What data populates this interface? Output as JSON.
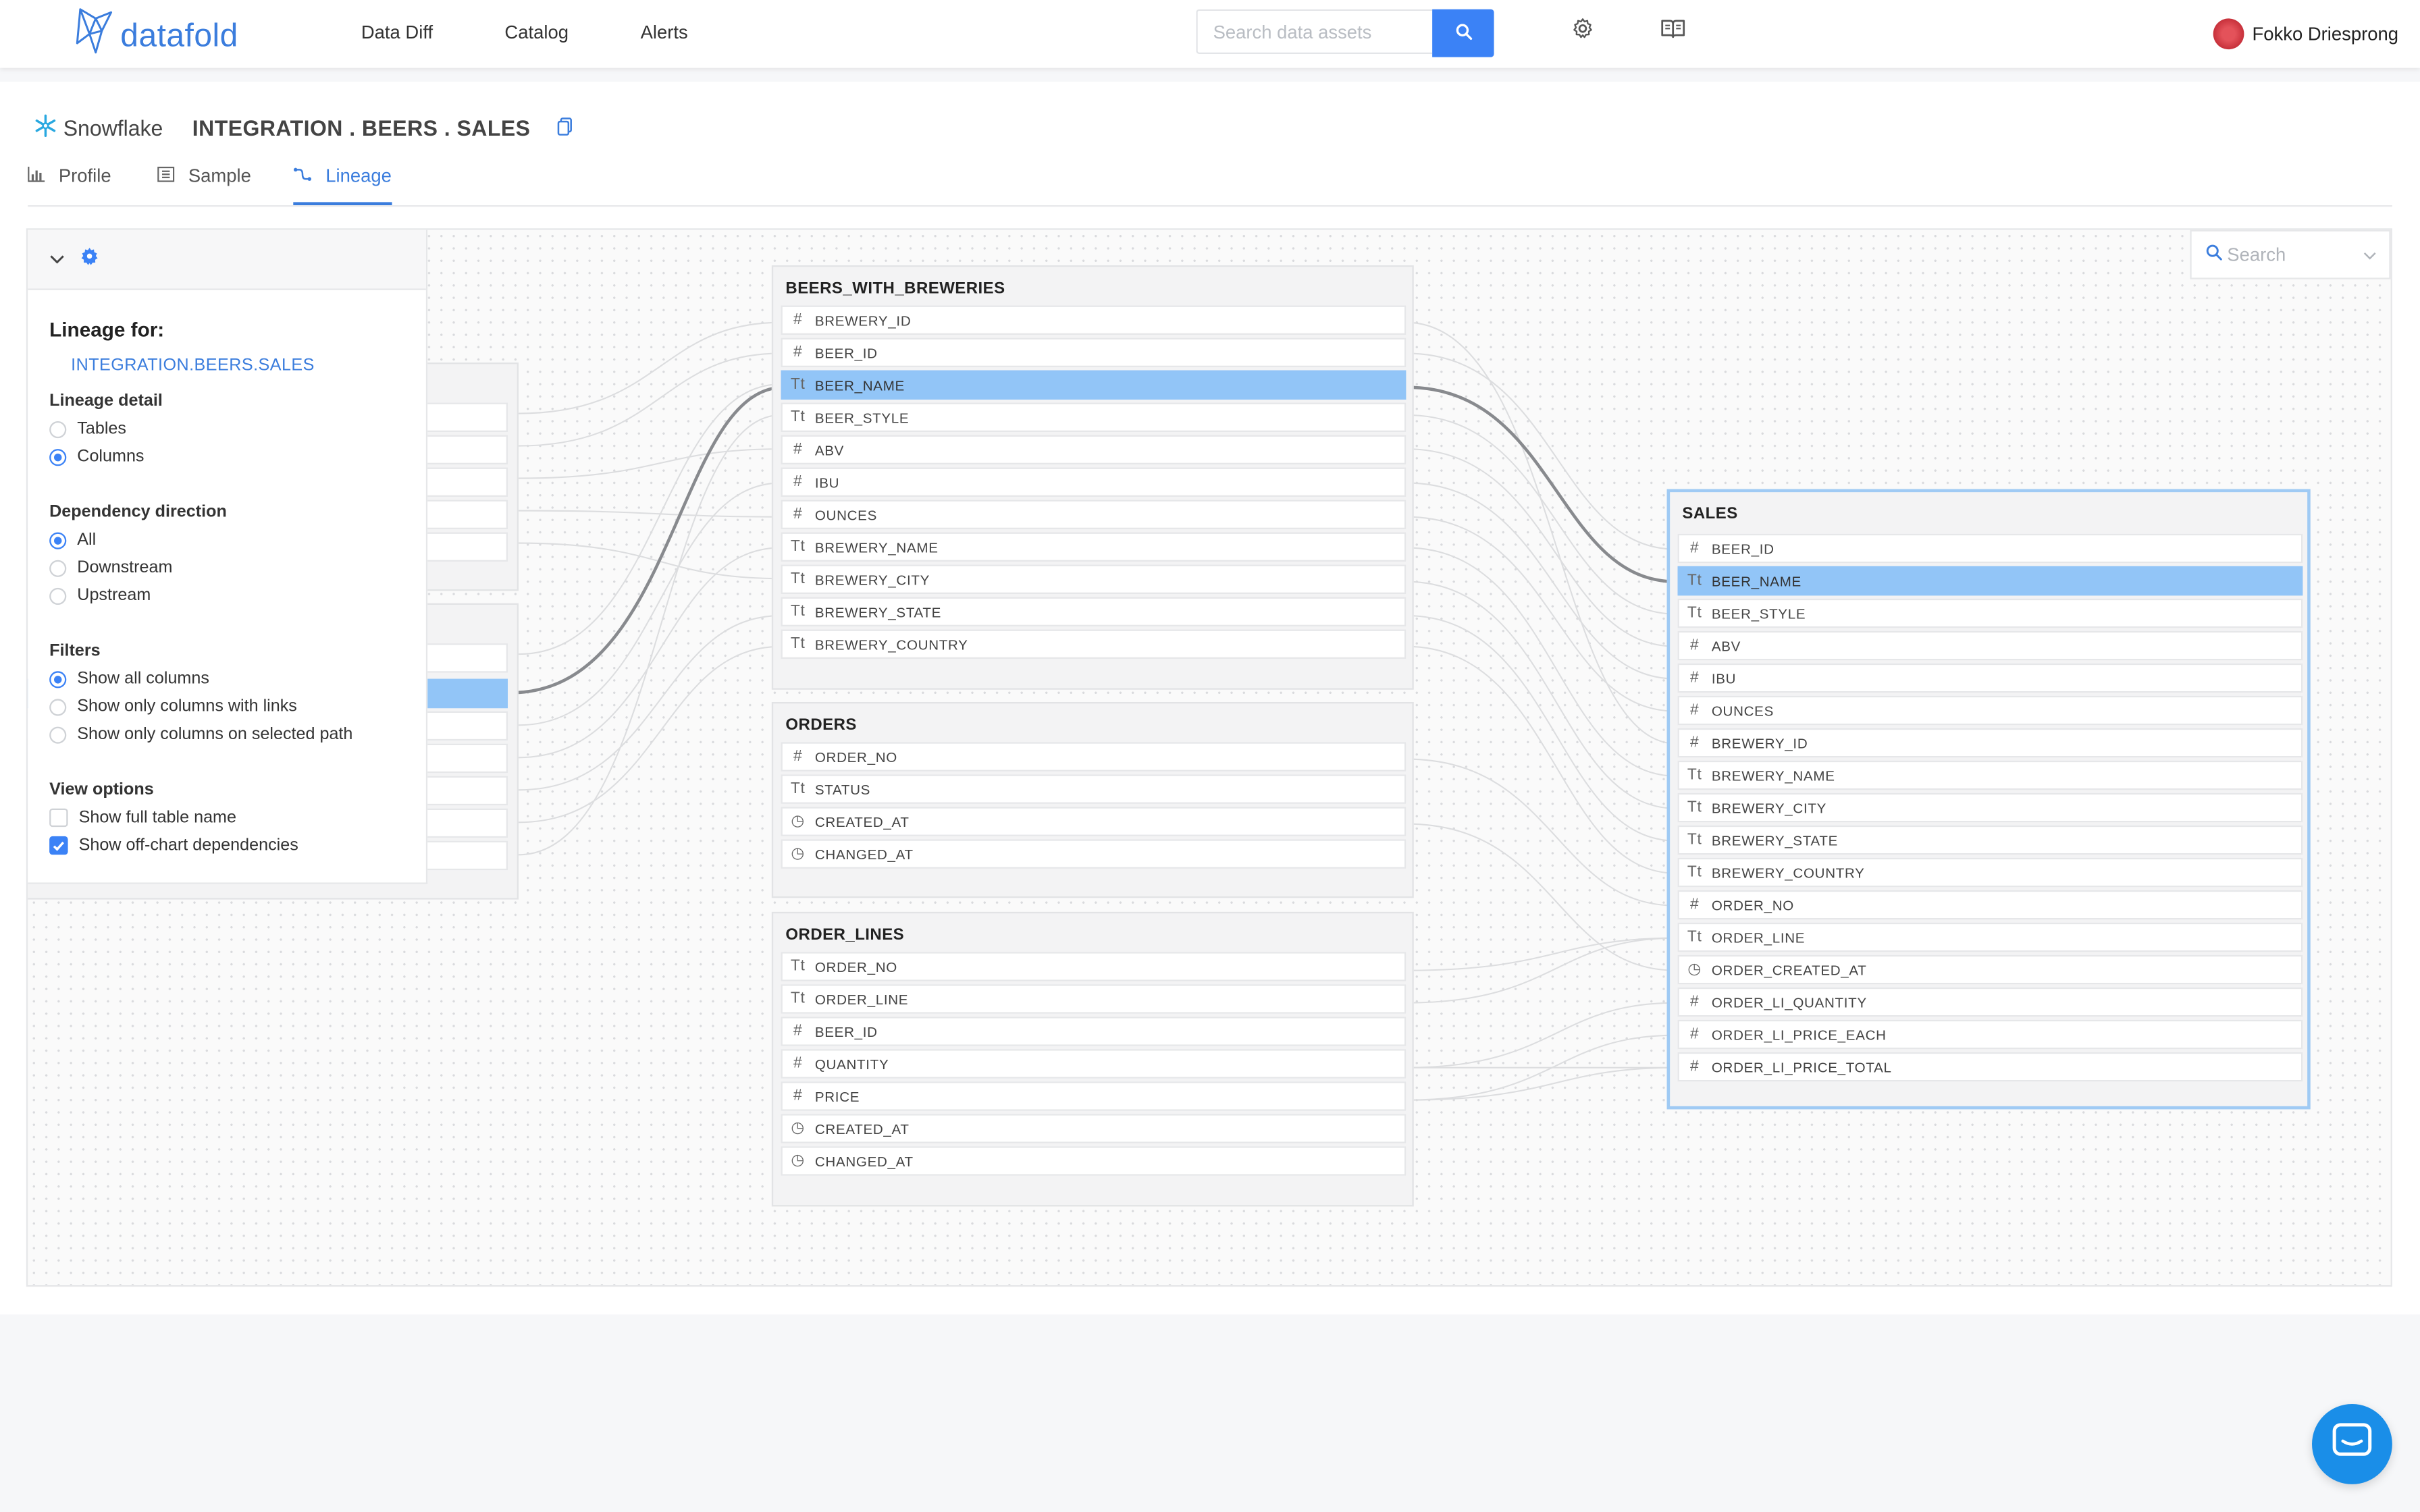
{
  "app": {
    "brand": "datafold"
  },
  "nav": {
    "items": [
      "Data Diff",
      "Catalog",
      "Alerts"
    ]
  },
  "search": {
    "placeholder": "Search data assets"
  },
  "user": {
    "name": "Fokko Driesprong"
  },
  "breadcrumb": {
    "source": "Snowflake",
    "path": "INTEGRATION . BEERS . SALES"
  },
  "tabs": [
    {
      "label": "Profile",
      "active": false
    },
    {
      "label": "Sample",
      "active": false
    },
    {
      "label": "Lineage",
      "active": true
    }
  ],
  "settings": {
    "lineage_for_label": "Lineage for:",
    "lineage_for_value": "INTEGRATION.BEERS.SALES",
    "lineage_detail": {
      "title": "Lineage detail",
      "options": [
        "Tables",
        "Columns"
      ],
      "selected": "Columns"
    },
    "dependency_direction": {
      "title": "Dependency direction",
      "options": [
        "All",
        "Downstream",
        "Upstream"
      ],
      "selected": "All"
    },
    "filters": {
      "title": "Filters",
      "options": [
        "Show all columns",
        "Show only columns with links",
        "Show only columns on selected path"
      ],
      "selected": "Show all columns"
    },
    "view_options": {
      "title": "View options",
      "options": [
        {
          "label": "Show full table name",
          "checked": false
        },
        {
          "label": "Show off-chart dependencies",
          "checked": true
        }
      ]
    }
  },
  "canvas_search": {
    "placeholder": "Search"
  },
  "tables": {
    "beers_with_breweries": {
      "name": "BEERS_WITH_BREWERIES",
      "columns": [
        {
          "name": "BREWERY_ID",
          "type": "number"
        },
        {
          "name": "BEER_ID",
          "type": "number"
        },
        {
          "name": "BEER_NAME",
          "type": "text",
          "highlighted": true
        },
        {
          "name": "BEER_STYLE",
          "type": "text"
        },
        {
          "name": "ABV",
          "type": "number"
        },
        {
          "name": "IBU",
          "type": "number"
        },
        {
          "name": "OUNCES",
          "type": "number"
        },
        {
          "name": "BREWERY_NAME",
          "type": "text"
        },
        {
          "name": "BREWERY_CITY",
          "type": "text"
        },
        {
          "name": "BREWERY_STATE",
          "type": "text"
        },
        {
          "name": "BREWERY_COUNTRY",
          "type": "text"
        }
      ]
    },
    "orders": {
      "name": "ORDERS",
      "columns": [
        {
          "name": "ORDER_NO",
          "type": "number"
        },
        {
          "name": "STATUS",
          "type": "text"
        },
        {
          "name": "CREATED_AT",
          "type": "time"
        },
        {
          "name": "CHANGED_AT",
          "type": "time"
        }
      ]
    },
    "order_lines": {
      "name": "ORDER_LINES",
      "columns": [
        {
          "name": "ORDER_NO",
          "type": "text"
        },
        {
          "name": "ORDER_LINE",
          "type": "text"
        },
        {
          "name": "BEER_ID",
          "type": "number"
        },
        {
          "name": "QUANTITY",
          "type": "number"
        },
        {
          "name": "PRICE",
          "type": "number"
        },
        {
          "name": "CREATED_AT",
          "type": "time"
        },
        {
          "name": "CHANGED_AT",
          "type": "time"
        }
      ]
    },
    "sales": {
      "name": "SALES",
      "columns": [
        {
          "name": "BEER_ID",
          "type": "number"
        },
        {
          "name": "BEER_NAME",
          "type": "text",
          "highlighted": true
        },
        {
          "name": "BEER_STYLE",
          "type": "text"
        },
        {
          "name": "ABV",
          "type": "number"
        },
        {
          "name": "IBU",
          "type": "number"
        },
        {
          "name": "OUNCES",
          "type": "number"
        },
        {
          "name": "BREWERY_ID",
          "type": "number"
        },
        {
          "name": "BREWERY_NAME",
          "type": "text"
        },
        {
          "name": "BREWERY_CITY",
          "type": "text"
        },
        {
          "name": "BREWERY_STATE",
          "type": "text"
        },
        {
          "name": "BREWERY_COUNTRY",
          "type": "text"
        },
        {
          "name": "ORDER_NO",
          "type": "number"
        },
        {
          "name": "ORDER_LINE",
          "type": "text"
        },
        {
          "name": "ORDER_CREATED_AT",
          "type": "time"
        },
        {
          "name": "ORDER_LI_QUANTITY",
          "type": "number"
        },
        {
          "name": "ORDER_LI_PRICE_EACH",
          "type": "number"
        },
        {
          "name": "ORDER_LI_PRICE_TOTAL",
          "type": "number"
        }
      ]
    }
  },
  "colors": {
    "accent": "#3b82f6",
    "highlight_row": "#92c5f7",
    "selected_table_border": "#9fcaf4"
  }
}
